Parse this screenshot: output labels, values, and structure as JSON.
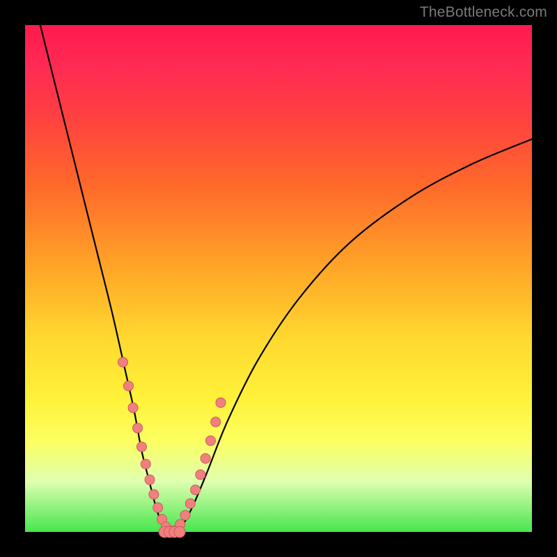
{
  "watermark": "TheBottleneck.com",
  "chart_data": {
    "type": "line",
    "title": "",
    "xlabel": "",
    "ylabel": "",
    "xlim": [
      0,
      100
    ],
    "ylim": [
      0,
      100
    ],
    "grid": false,
    "legend": false,
    "curve_left": {
      "x": [
        3,
        5,
        8,
        11,
        14,
        17,
        19.5,
        21.5,
        23,
        24.5,
        25.8,
        27,
        28
      ],
      "y": [
        100,
        92,
        80,
        68,
        56,
        44,
        33,
        24,
        16,
        10,
        5,
        1.5,
        0
      ]
    },
    "curve_right": {
      "x": [
        30,
        31.5,
        33.5,
        36,
        40,
        46,
        54,
        64,
        76,
        88,
        100
      ],
      "y": [
        0,
        2,
        6,
        12,
        22,
        34,
        46,
        57,
        66,
        72.5,
        77.5
      ]
    },
    "markers_left": {
      "x": [
        19.3,
        20.4,
        21.3,
        22.2,
        23.0,
        23.8,
        24.6,
        25.4,
        26.2,
        27.0,
        27.8,
        28.6
      ],
      "y": [
        33.5,
        28.8,
        24.5,
        20.5,
        16.8,
        13.4,
        10.3,
        7.4,
        4.8,
        2.5,
        1.0,
        0.2
      ]
    },
    "markers_right": {
      "x": [
        29.6,
        30.6,
        31.6,
        32.6,
        33.6,
        34.6,
        35.6,
        36.6,
        37.6,
        38.6
      ],
      "y": [
        0.3,
        1.5,
        3.3,
        5.6,
        8.3,
        11.3,
        14.5,
        18.0,
        21.7,
        25.5
      ]
    },
    "markers_floor": {
      "x": [
        27.5,
        28.5,
        29.5,
        30.5
      ],
      "y": [
        0.0,
        0.0,
        0.0,
        0.0
      ]
    },
    "gradient_note": "Background vertical gradient red→orange→yellow→green top-to-bottom"
  }
}
